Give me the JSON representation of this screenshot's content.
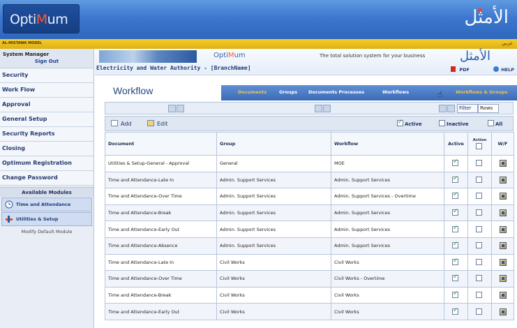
{
  "banner": {
    "logo_prefix": "Opti",
    "logo_accent": "M",
    "logo_suffix": "um",
    "arabic_logo": "الأمثل",
    "org_strip": "AL-MISTAWA MODEL",
    "arabic_link": "عربي"
  },
  "sidebar": {
    "user_name": "System Manager",
    "sign_out": "Sign Out",
    "items": [
      {
        "label": "Security"
      },
      {
        "label": "Work Flow"
      },
      {
        "label": "Approval"
      },
      {
        "label": "General Setup"
      },
      {
        "label": "Security Reports"
      },
      {
        "label": "Closing"
      },
      {
        "label": "Optimum Registration"
      },
      {
        "label": "Change Password"
      }
    ],
    "modules_heading": "Available Modules",
    "modules": [
      {
        "label": "Time and Attendance",
        "icon": "clock-icon"
      },
      {
        "label": "Utilities & Setup",
        "icon": "tools-icon"
      }
    ],
    "modify_default": "Modify Default Module"
  },
  "header": {
    "logo_prefix": "Opti",
    "logo_accent": "M",
    "logo_suffix": "um",
    "tagline": "The total solution system for your business",
    "arabic_logo": "الأمثل",
    "org_title": "Electricity and Water Authority - [BranchName]",
    "pdf_label": "PDF",
    "help_label": "HELP"
  },
  "workflow": {
    "title": "Workflow",
    "tabs": [
      {
        "label": "Documents",
        "state": "active"
      },
      {
        "label": "Groups",
        "state": "normal"
      },
      {
        "label": "Documents Processes",
        "state": "normal"
      },
      {
        "label": "Workflows",
        "state": "normal"
      },
      {
        "label": "Workflows & Groups",
        "state": "hover"
      }
    ]
  },
  "filter": {
    "filter_label": "Filter",
    "filter_value": "Rows"
  },
  "toolbar": {
    "add_label": "Add",
    "edit_label": "Edit",
    "active_label": "Active",
    "inactive_label": "Inactive",
    "all_label": "All",
    "active_checked": true,
    "inactive_checked": false,
    "all_checked": false
  },
  "table": {
    "columns": [
      "Document",
      "Group",
      "Workflow",
      "Active",
      "Action",
      "W/F"
    ],
    "action_sub": "None",
    "rows": [
      {
        "document": "Utilities & Setup-General - Approval",
        "group": "General",
        "workflow": "MOE",
        "active": true,
        "action": false
      },
      {
        "document": "Time and Attendance-Late In",
        "group": "Admin. Support Services",
        "workflow": "Admin. Support Services",
        "active": true,
        "action": false
      },
      {
        "document": "Time and Attendance-Over Time",
        "group": "Admin. Support Services",
        "workflow": "Admin. Support Services - Overtime",
        "active": true,
        "action": false
      },
      {
        "document": "Time and Attendance-Break",
        "group": "Admin. Support Services",
        "workflow": "Admin. Support Services",
        "active": true,
        "action": false
      },
      {
        "document": "Time and Attendance-Early Out",
        "group": "Admin. Support Services",
        "workflow": "Admin. Support Services",
        "active": true,
        "action": false
      },
      {
        "document": "Time and Attendance-Absence",
        "group": "Admin. Support Services",
        "workflow": "Admin. Support Services",
        "active": true,
        "action": false
      },
      {
        "document": "Time and Attendance-Late In",
        "group": "Civil Works",
        "workflow": "Civil Works",
        "active": true,
        "action": false
      },
      {
        "document": "Time and Attendance-Over Time",
        "group": "Civil Works",
        "workflow": "Civil Works - Overtime",
        "active": true,
        "action": false
      },
      {
        "document": "Time and Attendance-Break",
        "group": "Civil Works",
        "workflow": "Civil Works",
        "active": true,
        "action": false
      },
      {
        "document": "Time and Attendance-Early Out",
        "group": "Civil Works",
        "workflow": "Civil Works",
        "active": true,
        "action": false
      }
    ]
  }
}
